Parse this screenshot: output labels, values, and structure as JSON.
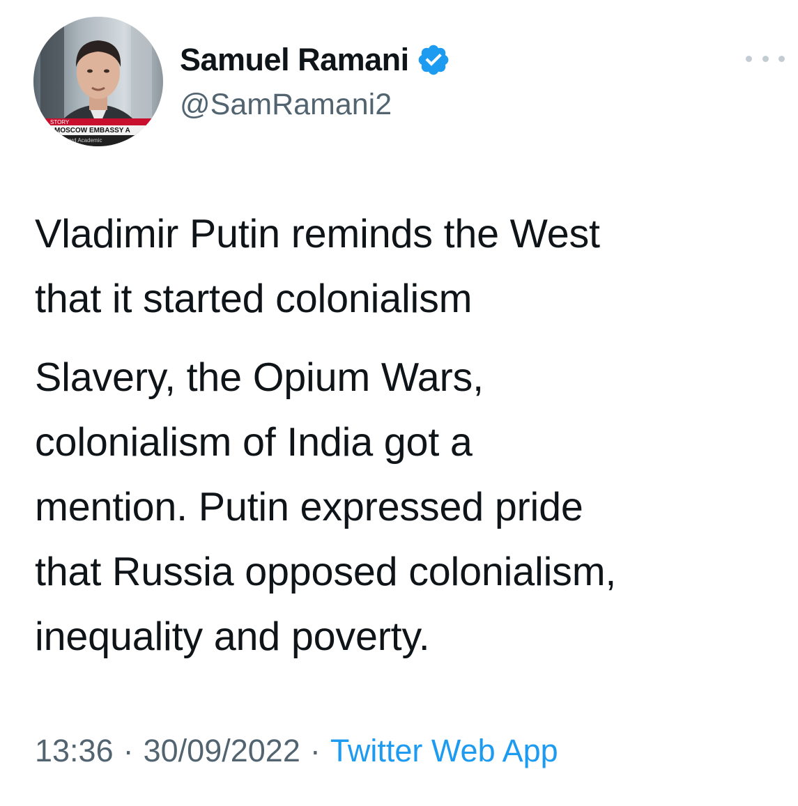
{
  "author": {
    "display_name": "Samuel Ramani",
    "handle": "@SamRamani2",
    "verified": true,
    "avatar_caption_lines": [
      "STORY",
      "MOSCOW EMBASSY A",
      "ord Academic"
    ]
  },
  "menu": {
    "icon": "more-dots-icon"
  },
  "tweet": {
    "paragraphs": [
      "Vladimir Putin reminds the West\nthat it started colonialism",
      "Slavery, the Opium Wars,\ncolonialism of India got a\nmention. Putin expressed pride\nthat Russia opposed colonialism,\ninequality and poverty."
    ]
  },
  "meta": {
    "time": "13:36",
    "date": "30/09/2022",
    "separator": "·",
    "source": "Twitter Web App"
  },
  "colors": {
    "text": "#0f1419",
    "muted": "#536471",
    "link": "#1d9bf0",
    "verified": "#1d9bf0",
    "more_dots": "#c4ccd3"
  }
}
